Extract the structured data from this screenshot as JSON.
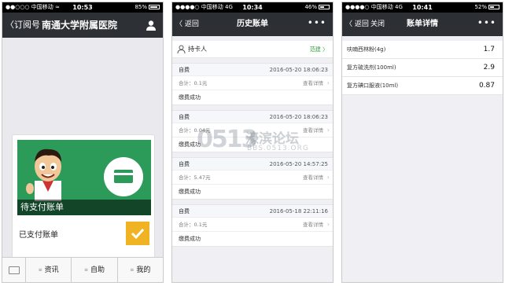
{
  "phone1": {
    "status": {
      "carrier": "●●○○○ 中国移动",
      "wifi": "≈",
      "time": "10:53",
      "battery": "85%",
      "battery_level": 0.85
    },
    "nav": {
      "back": "〈订阅号",
      "title": "南通大学附属医院"
    },
    "card": {
      "banner_label": "待支付账单",
      "paid_label": "已支付账单"
    },
    "menu": [
      {
        "label": "资讯",
        "marker": "≡"
      },
      {
        "label": "自助",
        "marker": "≡"
      },
      {
        "label": "我的",
        "marker": "≡"
      }
    ]
  },
  "phone2": {
    "status": {
      "carrier": "●●●●○ 中国移动",
      "network": "4G",
      "time": "10:34",
      "battery": "46%",
      "battery_level": 0.46
    },
    "nav": {
      "back": "〈 返回",
      "title": "历史账单",
      "more": "•••"
    },
    "holder": {
      "name": "持卡人",
      "link": "范建 〉"
    },
    "records": [
      {
        "type": "自费",
        "date": "2016-05-20 18:06:23",
        "amount": "合计：0.1元",
        "detail": "查看详情",
        "status": "缴费成功"
      },
      {
        "type": "自费",
        "date": "2016-05-20 18:06:23",
        "amount": "合计：0.04元",
        "detail": "查看详情",
        "status": "缴费成功"
      },
      {
        "type": "自费",
        "date": "2016-05-20 14:57:25",
        "amount": "合计：5.47元",
        "detail": "查看详情",
        "status": "缴费成功"
      },
      {
        "type": "自费",
        "date": "2016-05-18 22:11:16",
        "amount": "合计：0.1元",
        "detail": "查看详情",
        "status": "缴费成功"
      }
    ]
  },
  "phone3": {
    "status": {
      "carrier": "●●●●○ 中国移动",
      "network": "4G",
      "time": "10:41",
      "battery": "52%",
      "battery_level": 0.52
    },
    "nav": {
      "back": "〈 返回",
      "close": "关闭",
      "title": "账单详情",
      "more": "•••"
    },
    "items": [
      {
        "name": "呋喃西林粉(4g)",
        "qty": "1.7"
      },
      {
        "name": "复方硫洗剂(100ml)",
        "qty": "2.9"
      },
      {
        "name": "复方碘口服液(10ml)",
        "qty": "0.87"
      }
    ]
  },
  "watermark": {
    "logo": "0513",
    "name": "濠滨论坛",
    "url": "BBS.0513.ORG"
  },
  "colors": {
    "nav": "#2c3035",
    "accent_green": "#2c9a59",
    "check_yellow": "#f0b323",
    "link_green": "#2a9d3a"
  }
}
